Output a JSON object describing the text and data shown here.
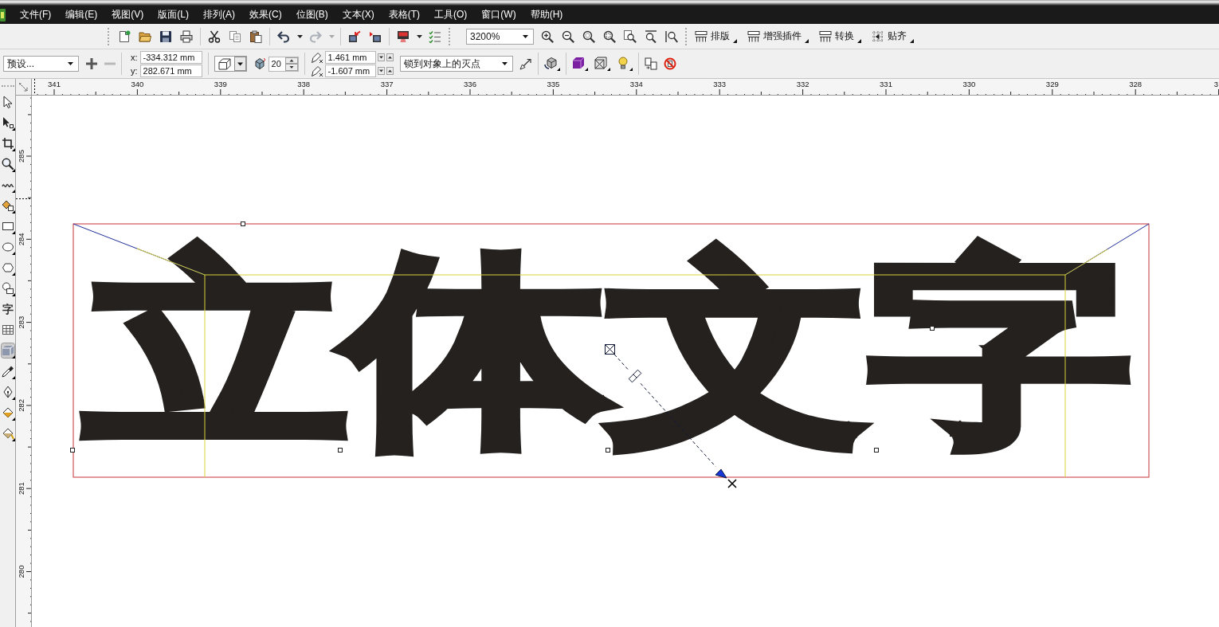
{
  "menu_bar": {
    "items": [
      "文件(F)",
      "编辑(E)",
      "视图(V)",
      "版面(L)",
      "排列(A)",
      "效果(C)",
      "位图(B)",
      "文本(X)",
      "表格(T)",
      "工具(O)",
      "窗口(W)",
      "帮助(H)"
    ]
  },
  "toolbars": [
    {
      "groups": [
        [
          {
            "kind": "icon",
            "dropdown": false,
            "disabled": false
          },
          {
            "kind": "icon",
            "dropdown": false,
            "disabled": false
          },
          {
            "kind": "icon",
            "dropdown": false,
            "disabled": false
          },
          {
            "kind": "icon",
            "dropdown": false,
            "disabled": false
          }
        ],
        [
          {
            "kind": "icon",
            "dropdown": false,
            "disabled": false
          },
          {
            "kind": "icon",
            "dropdown": false,
            "disabled": false
          },
          {
            "kind": "icon",
            "dropdown": false,
            "disabled": false
          }
        ],
        [
          {
            "kind": "icon",
            "dropdown": true,
            "disabled": false
          },
          {
            "kind": "icon",
            "dropdown": true,
            "disabled": true
          }
        ],
        [
          {
            "kind": "icon",
            "dropdown": false,
            "disabled": false
          },
          {
            "kind": "icon",
            "dropdown": false,
            "disabled": false
          }
        ],
        [
          {
            "kind": "icon",
            "dropdown": true,
            "disabled": false
          },
          {
            "kind": "icon",
            "dropdown": false,
            "disabled": false
          }
        ]
      ]
    },
    {
      "groups": [
        [
          {
            "kind": "combo",
            "value": "3200%"
          },
          {
            "kind": "icon",
            "dropdown": false,
            "disabled": false
          },
          {
            "kind": "icon",
            "dropdown": false,
            "disabled": false
          },
          {
            "kind": "icon",
            "dropdown": false,
            "disabled": false
          },
          {
            "kind": "icon",
            "dropdown": false,
            "disabled": false
          },
          {
            "kind": "icon",
            "dropdown": false,
            "disabled": false
          },
          {
            "kind": "icon",
            "dropdown": false,
            "disabled": false
          },
          {
            "kind": "icon",
            "dropdown": false,
            "disabled": false
          }
        ]
      ]
    },
    {
      "groups": [
        [
          {
            "kind": "labeled",
            "label": "排版",
            "flyout": true
          },
          {
            "kind": "labeled",
            "label": "增强插件",
            "flyout": true
          },
          {
            "kind": "labeled",
            "label": "转换",
            "flyout": true
          },
          {
            "kind": "labeled",
            "label": "贴齐",
            "flyout": true
          }
        ]
      ]
    }
  ],
  "property_bar": {
    "groups": [
      [
        {
          "kind": "combo",
          "value": "预设..."
        },
        {
          "kind": "icon",
          "flyout": false,
          "disabled": false
        },
        {
          "kind": "icon",
          "flyout": false,
          "disabled": true
        }
      ],
      [
        {
          "kind": "coords",
          "fields": [
            {
              "label": "x:",
              "value": "-334.312 mm"
            },
            {
              "label": "y:",
              "value": "282.671 mm"
            }
          ]
        }
      ],
      [
        {
          "kind": "icon_combo"
        },
        {
          "kind": "spin",
          "value": "20"
        }
      ],
      [
        {
          "kind": "vp_coords",
          "fields": [
            {
              "value": "1.461 mm"
            },
            {
              "value": "-1.607 mm"
            }
          ]
        },
        {
          "kind": "combo",
          "value": "锁到对象上的灭点"
        },
        {
          "kind": "icon",
          "flyout": false,
          "disabled": false
        }
      ],
      [
        {
          "kind": "icon",
          "flyout": true,
          "disabled": false
        }
      ],
      [
        {
          "kind": "icon",
          "flyout": true,
          "disabled": false
        },
        {
          "kind": "icon",
          "flyout": true,
          "disabled": false
        },
        {
          "kind": "icon",
          "flyout": true,
          "disabled": false
        }
      ],
      [
        {
          "kind": "icon",
          "flyout": false,
          "disabled": false
        },
        {
          "kind": "icon",
          "flyout": false,
          "disabled": false
        }
      ]
    ]
  },
  "rulers": {
    "horizontal": [
      "341",
      "340",
      "339",
      "338",
      "337",
      "336",
      "335",
      "334",
      "333",
      "332",
      "331",
      "330",
      "329",
      "328",
      "3"
    ],
    "vertical": [
      "285",
      "284",
      "283",
      "282",
      "281",
      "280"
    ]
  },
  "toolbox": {
    "tools": [
      {
        "kind": "icon",
        "selected": false,
        "flyout": false
      },
      {
        "kind": "icon",
        "selected": false,
        "flyout": true
      },
      {
        "kind": "icon",
        "selected": false,
        "flyout": true
      },
      {
        "kind": "icon",
        "selected": false,
        "flyout": true
      },
      {
        "kind": "icon",
        "selected": false,
        "flyout": true
      },
      {
        "kind": "icon",
        "selected": false,
        "flyout": true
      },
      {
        "kind": "icon",
        "selected": false,
        "flyout": true
      },
      {
        "kind": "icon",
        "selected": false,
        "flyout": true
      },
      {
        "kind": "icon",
        "selected": false,
        "flyout": true
      },
      {
        "kind": "icon",
        "selected": false,
        "flyout": true
      },
      {
        "kind": "glyph",
        "glyph": "字",
        "selected": false,
        "flyout": false
      },
      {
        "kind": "icon",
        "selected": false,
        "flyout": false
      },
      {
        "kind": "icon",
        "selected": true,
        "flyout": true
      },
      {
        "kind": "icon",
        "selected": false,
        "flyout": true
      },
      {
        "kind": "icon",
        "selected": false,
        "flyout": true
      },
      {
        "kind": "icon",
        "selected": false,
        "flyout": true
      },
      {
        "kind": "icon",
        "selected": false,
        "flyout": true
      }
    ]
  },
  "canvas": {
    "artwork_text": "立体文字"
  }
}
